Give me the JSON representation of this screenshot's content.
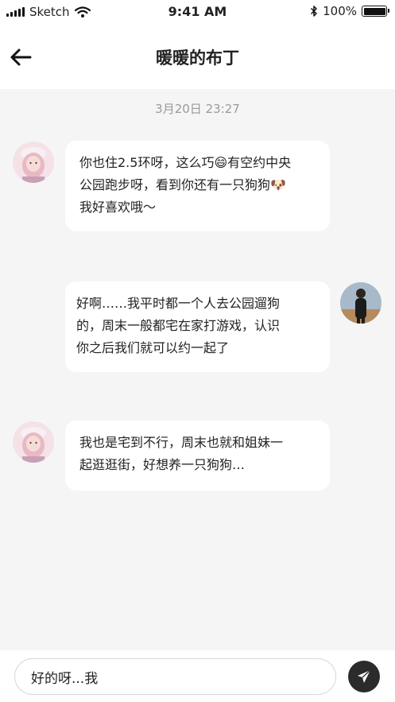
{
  "status_bar": {
    "carrier": "Sketch",
    "time": "9:41 AM",
    "battery": "100%"
  },
  "header": {
    "title": "暖暖的布丁"
  },
  "chat": {
    "timestamp": "3月20日 23:27",
    "messages": [
      {
        "sender": "contact",
        "lines": [
          "你也住2.5环呀，这么巧😄有空约中央",
          "公园跑步呀，看到你还有一只狗狗🐶",
          "我好喜欢哦～"
        ]
      },
      {
        "sender": "me",
        "lines": [
          "好啊……我平时都一个人去公园遛狗",
          "的，周末一般都宅在家打游戏，认识",
          "你之后我们就可以约一起了"
        ]
      },
      {
        "sender": "contact",
        "lines": [
          "我也是宅到不行，周末也就和姐妹一",
          "起逛逛街，好想养一只狗狗…"
        ]
      }
    ]
  },
  "input": {
    "value": "好的呀...我"
  },
  "icons": {
    "back": "arrow-left-icon",
    "send": "paper-plane-icon",
    "wifi": "wifi-icon",
    "bluetooth": "bluetooth-icon"
  },
  "colors": {
    "background": "#f6f5f6",
    "bubble": "#ffffff",
    "send_button": "#2b2b2b",
    "timestamp": "#9a9a9a"
  }
}
